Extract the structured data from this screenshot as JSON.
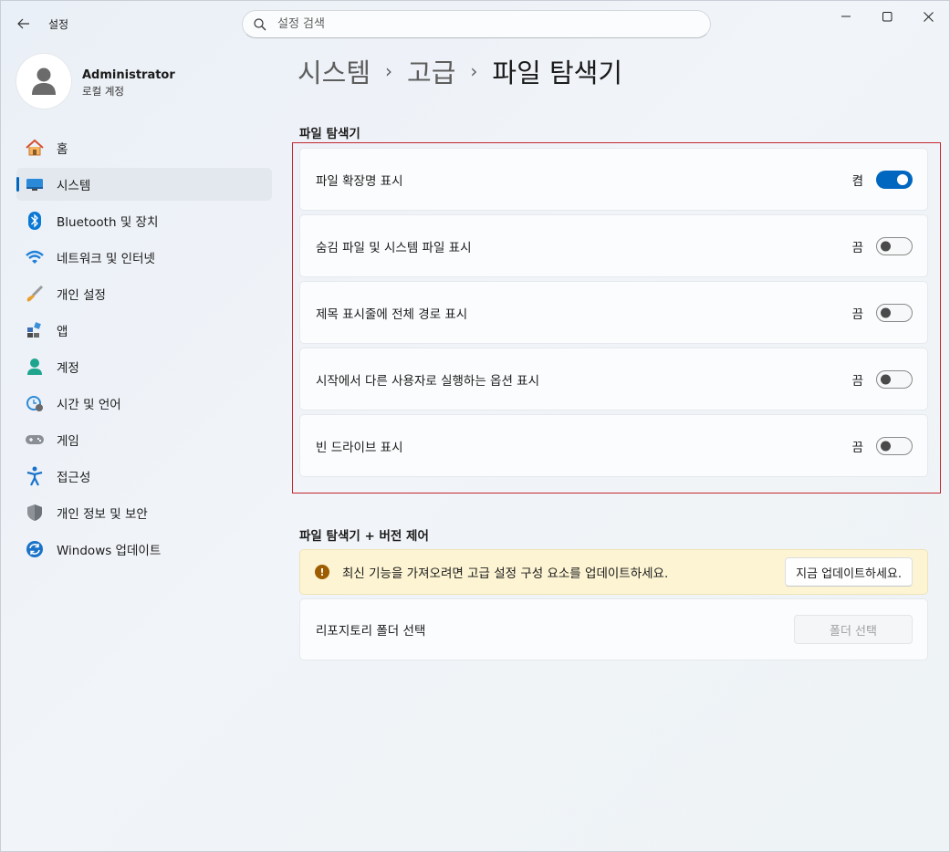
{
  "window": {
    "title": "설정",
    "back_icon": "back-arrow-icon",
    "controls": [
      "minimize-icon",
      "maximize-icon",
      "close-icon"
    ]
  },
  "search": {
    "placeholder": "설정 검색"
  },
  "profile": {
    "name": "Administrator",
    "type": "로컬 계정"
  },
  "sidebar": {
    "items": [
      {
        "label": "홈",
        "icon": "home-icon"
      },
      {
        "label": "시스템",
        "icon": "system-icon",
        "active": true
      },
      {
        "label": "Bluetooth 및 장치",
        "icon": "bluetooth-icon"
      },
      {
        "label": "네트워크 및 인터넷",
        "icon": "wifi-icon"
      },
      {
        "label": "개인 설정",
        "icon": "paintbrush-icon"
      },
      {
        "label": "앱",
        "icon": "apps-icon"
      },
      {
        "label": "계정",
        "icon": "account-icon"
      },
      {
        "label": "시간 및 언어",
        "icon": "time-language-icon"
      },
      {
        "label": "게임",
        "icon": "gamepad-icon"
      },
      {
        "label": "접근성",
        "icon": "accessibility-icon"
      },
      {
        "label": "개인 정보 및 보안",
        "icon": "shield-icon"
      },
      {
        "label": "Windows 업데이트",
        "icon": "windows-update-icon"
      }
    ]
  },
  "breadcrumb": {
    "parts": [
      "시스템",
      "고급"
    ],
    "current": "파일 탐색기"
  },
  "file_explorer": {
    "heading": "파일 탐색기",
    "settings": [
      {
        "label": "파일 확장명 표시",
        "state": "켬",
        "on": true
      },
      {
        "label": "숨김 파일 및 시스템 파일 표시",
        "state": "끔",
        "on": false
      },
      {
        "label": "제목 표시줄에 전체 경로 표시",
        "state": "끔",
        "on": false
      },
      {
        "label": "시작에서 다른 사용자로 실행하는 옵션 표시",
        "state": "끔",
        "on": false
      },
      {
        "label": "빈 드라이브 표시",
        "state": "끔",
        "on": false
      }
    ]
  },
  "version_control": {
    "heading": "파일 탐색기 + 버전 제어",
    "warning_text": "최신 기능을 가져오려면 고급 설정 구성 요소를 업데이트하세요.",
    "warning_icon": "warning-icon",
    "update_button": "지금 업데이트하세요.",
    "repo_label": "리포지토리 폴더 선택",
    "repo_button": "폴더 선택"
  },
  "colors": {
    "accent": "#0067c0",
    "highlight_border": "#c4262e",
    "warning_bg": "#fdf4d3"
  }
}
